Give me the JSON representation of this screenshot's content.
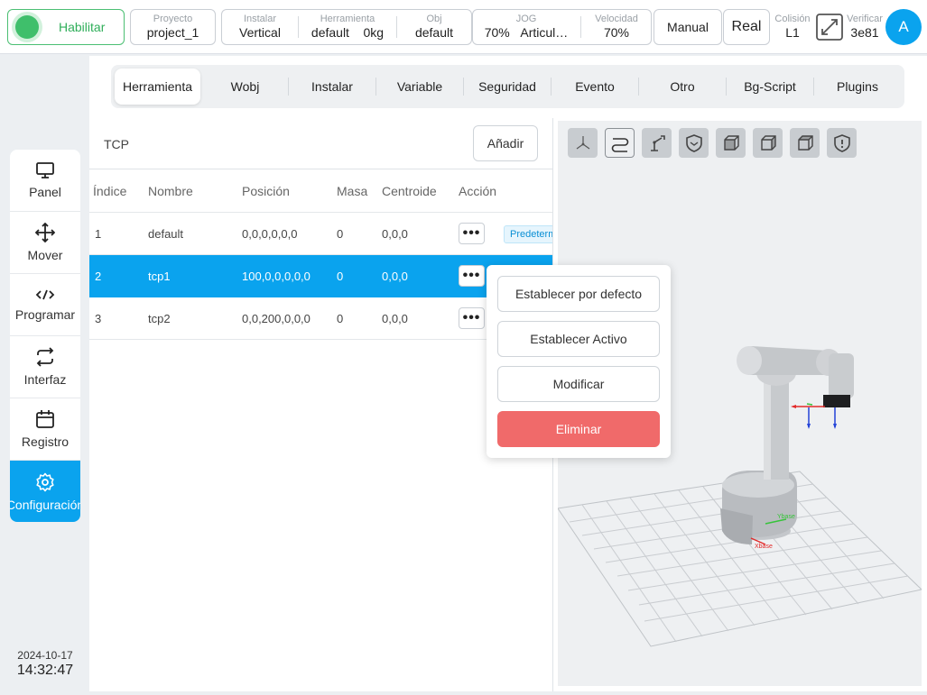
{
  "topbar": {
    "enable_label": "Habilitar",
    "project": {
      "label": "Proyecto",
      "value": "project_1"
    },
    "install": {
      "label": "Instalar",
      "value": "Vertical"
    },
    "tool": {
      "label": "Herramienta",
      "value": "default",
      "mass": "0kg"
    },
    "obj": {
      "label": "Obj",
      "value": "default"
    },
    "jog": {
      "label": "JOG",
      "value": "70%",
      "mode": "Articul…"
    },
    "speed": {
      "label": "Velocidad",
      "value": "70%"
    },
    "manual_label": "Manual",
    "real_label": "Real",
    "collision": {
      "label": "Colisión",
      "value": "L1"
    },
    "verify": {
      "label": "Verificar",
      "value": "3e81"
    },
    "avatar_letter": "A"
  },
  "nav": {
    "items": [
      {
        "label": "Panel",
        "icon": "monitor-icon"
      },
      {
        "label": "Mover",
        "icon": "move-icon"
      },
      {
        "label": "Programar",
        "icon": "code-icon"
      },
      {
        "label": "Interfaz",
        "icon": "swap-icon"
      },
      {
        "label": "Registro",
        "icon": "calendar-icon"
      },
      {
        "label": "Configuración",
        "icon": "gear-icon"
      }
    ],
    "date": "2024-10-17",
    "time": "14:32:47"
  },
  "tabs": [
    {
      "label": "Herramienta"
    },
    {
      "label": "Wobj"
    },
    {
      "label": "Instalar"
    },
    {
      "label": "Variable"
    },
    {
      "label": "Seguridad"
    },
    {
      "label": "Evento"
    },
    {
      "label": "Otro"
    },
    {
      "label": "Bg-Script"
    },
    {
      "label": "Plugins"
    }
  ],
  "tcp": {
    "title": "TCP",
    "add_label": "Añadir",
    "columns": [
      "Índice",
      "Nombre",
      "Posición",
      "Masa",
      "Centroide",
      "Acción"
    ],
    "rows": [
      {
        "index": "1",
        "name": "default",
        "position": "0,0,0,0,0,0",
        "mass": "0",
        "centroid": "0,0,0",
        "badge": "Predeterminado"
      },
      {
        "index": "2",
        "name": "tcp1",
        "position": "100,0,0,0,0,0",
        "mass": "0",
        "centroid": "0,0,0"
      },
      {
        "index": "3",
        "name": "tcp2",
        "position": "0,0,200,0,0,0",
        "mass": "0",
        "centroid": "0,0,0"
      }
    ],
    "more_label": "•••"
  },
  "popup": {
    "set_default": "Establecer por defecto",
    "set_active": "Establecer Activo",
    "modify": "Modificar",
    "delete": "Eliminar"
  },
  "viewer": {
    "tools": [
      "axes-view-icon",
      "path-icon",
      "robot-icon",
      "shield-icon",
      "cube-front-icon",
      "cube-side-icon",
      "cube-top-icon",
      "warning-shield-icon"
    ],
    "base_x_label": "Xbase",
    "base_y_label": "Ybase"
  },
  "colors": {
    "accent": "#0aa3ee",
    "enable": "#3fbf6b",
    "danger": "#f06a6a"
  }
}
